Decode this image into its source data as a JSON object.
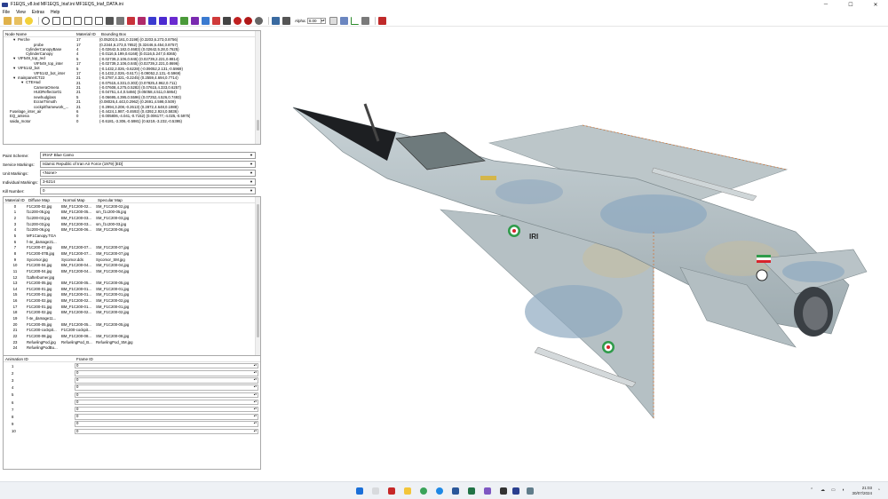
{
  "window": {
    "title": "F1EQS_v8.lod  MF1EQS_Iriaf.ini  MF1EQS_Iriaf_DATA.ini",
    "minimize": "─",
    "maximize": "☐",
    "close": "✕"
  },
  "menu": [
    "File",
    "View",
    "Extras",
    "Help"
  ],
  "toolbar": {
    "alpha_label": "Alpha:",
    "alpha_value": "0.00"
  },
  "tree": {
    "headers": [
      "Node Name",
      "Material ID",
      "Bounding Box"
    ],
    "rows": [
      {
        "name": "Perche",
        "indent": 1,
        "expander": "▾",
        "mat": "17",
        "bbox": "(0.05202,5.161,0.3198) (0.3203,6.273,0.8756)"
      },
      {
        "name": "probe",
        "indent": 3,
        "expander": "",
        "mat": "17",
        "bbox": "(0.2344,6.273,0.7852) (0.32446,6.454,0.8757)"
      },
      {
        "name": "CylinderCanopyBase",
        "indent": 2,
        "expander": "",
        "mat": "4",
        "bbox": "(-0.02642,5.182,0.4683) (0.02642,5.28,0.7625)"
      },
      {
        "name": "CylinderCanopy",
        "indent": 2,
        "expander": "",
        "mat": "4",
        "bbox": "(-0.0116,5.199,0.6168) (0.0116,5.247,0.8365)"
      },
      {
        "name": "VIF549_top_red",
        "indent": 1,
        "expander": "▾",
        "mat": "5",
        "bbox": "(-0.02739,2.106,0.845) (0.02739,2.221,0.8814)"
      },
      {
        "name": "VIF549_top_inter",
        "indent": 3,
        "expander": "",
        "mat": "17",
        "bbox": "(-0.02739,2.106,0.845) (0.02739,2.221,0.8696)"
      },
      {
        "name": "VIF5142_bot",
        "indent": 1,
        "expander": "▾",
        "mat": "5",
        "bbox": "(-0.1432,2.026,-0.6228) (-0.09052,2.131,-0.5969)"
      },
      {
        "name": "VIF5142_bot_inter",
        "indent": 3,
        "expander": "",
        "mat": "17",
        "bbox": "(-0.1432,2.026,-0.617) (-0.09052,2.131,-0.5969)"
      },
      {
        "name": "mainpanelCT22",
        "indent": 1,
        "expander": "▾",
        "mat": "21",
        "bbox": "(-0.2787,4.321,-0.2245) (0.2559,4.694,0.7714)"
      },
      {
        "name": "CTEHud",
        "indent": 2,
        "expander": "▾",
        "mat": "21",
        "bbox": "(-0.07515,4.331,0.303) (0.07825,4.962,0.711)"
      },
      {
        "name": "CameraOmera",
        "indent": 3,
        "expander": "",
        "mat": "21",
        "bbox": "(-0.07608,4.275,0.5282) (0.07615,4.333,0.6257)"
      },
      {
        "name": "HUDReflector01",
        "indent": 3,
        "expander": "",
        "mat": "21",
        "bbox": "(-0.04751,4.4,0.5466) (0.05058,4.511,0.5864)"
      },
      {
        "name": "newhudglass",
        "indent": 3,
        "expander": "",
        "mat": "5",
        "bbox": "(-0.06695,4.395,0.5596) (0.07252,4.526,0.7493)"
      },
      {
        "name": "EcranTrimoth",
        "indent": 3,
        "expander": "",
        "mat": "21",
        "bbox": "(0.08026,4.443,0.2962) (0.2691,4.598,0.509)"
      },
      {
        "name": "cockpitframework_...",
        "indent": 3,
        "expander": "",
        "mat": "21",
        "bbox": "(-0.2994,3.208,-0.2613) (0.2872,4.648,0.1988)"
      },
      {
        "name": "Fuselage_inter_air",
        "indent": 0,
        "expander": "",
        "mat": "6",
        "bbox": "(-0.4424,1.987,-0.4692) (0.4392,2.924,0.5836)"
      },
      {
        "name": "EQ_antena",
        "indent": 0,
        "expander": "",
        "mat": "0",
        "bbox": "(-0.005806,-4.041,-0.7152) (0.006177,-4.025,-0.5975)"
      },
      {
        "name": "saida_motor",
        "indent": 0,
        "expander": "",
        "mat": "0",
        "bbox": "(-0.6181,-3.306,-0.5981) (0.6219,-3.232,-0.5395)"
      }
    ]
  },
  "combos": [
    {
      "label": "Paint Scheme:",
      "value": "IRIAF Blue Camo"
    },
    {
      "label": "Service Markings:",
      "value": "Islamic Republic of Iran Air Force (1979) [ED]"
    },
    {
      "label": "Unit Markings:",
      "value": "<None>"
    },
    {
      "label": "Individual Markings:",
      "value": "3-6214"
    },
    {
      "label": "Kill Number:",
      "value": "0"
    }
  ],
  "materials": {
    "headers": [
      "Material ID",
      "Diffuse Map",
      "Normal Map",
      "Specular Map"
    ],
    "rows": [
      [
        "0",
        "F1C200-02.jpg",
        "BM_F1C200-02...",
        "SM_F1C200-02.jpg"
      ],
      [
        "1",
        "f1c200-05.jpg",
        "BM_F1C200-05...",
        "sm_f1c200-05.jpg"
      ],
      [
        "2",
        "f1c200-03.jpg",
        "BM_F1C200-03...",
        "SM_F1C200-03.jpg"
      ],
      [
        "3",
        "f1c200-03.jpg",
        "BM_F1C200-03...",
        "sm_f1c200-03.jpg"
      ],
      [
        "4",
        "f1c200-06.jpg",
        "BM_F1C200-06...",
        "SM_F1C200-06.jpg"
      ],
      [
        "5",
        "MF1Canopy.TGA",
        "",
        ""
      ],
      [
        "6",
        "f-4e_damage21...",
        "",
        ""
      ],
      [
        "7",
        "F1C200-07.jpg",
        "BM_F1C200-07...",
        "SM_F1C200-07.jpg"
      ],
      [
        "8",
        "F1C200-07B.jpg",
        "BM_F1C200-07...",
        "SM_F1C200-07.jpg"
      ],
      [
        "9",
        "Sycomor.jpg",
        "Sycomor.dds",
        "Sycomor_SM.jpg"
      ],
      [
        "10",
        "F1C200-04.jpg",
        "BM_F1C200-04...",
        "SM_F1C200-04.jpg"
      ],
      [
        "11",
        "F1C200-04.jpg",
        "BM_F1C200-04...",
        "SM_F1C200-04.jpg"
      ],
      [
        "12",
        "f1afterburner.jpg",
        "",
        ""
      ],
      [
        "13",
        "F1C200-05.jpg",
        "BM_F1C200-05...",
        "SM_F1C200-05.jpg"
      ],
      [
        "14",
        "F1C200-01.jpg",
        "BM_F1C200-01...",
        "SM_F1C200-01.jpg"
      ],
      [
        "15",
        "F1C200-01.jpg",
        "BM_F1C200-01...",
        "SM_F1C200-01.jpg"
      ],
      [
        "16",
        "F1C200-02.jpg",
        "BM_F1C200-02...",
        "SM_F1C200-02.jpg"
      ],
      [
        "17",
        "F1C200-01.jpg",
        "BM_F1C200-01...",
        "SM_F1C200-01.jpg"
      ],
      [
        "18",
        "F1C200-02.jpg",
        "BM_F1C200-02...",
        "SM_F1C200-02.jpg"
      ],
      [
        "19",
        "f-4e_damage11...",
        "",
        ""
      ],
      [
        "20",
        "F1C200-05.jpg",
        "BM_F1C200-05...",
        "SM_F1C200-05.jpg"
      ],
      [
        "21",
        "F1C200-cockpit...",
        "F1C200-cockpit...",
        ""
      ],
      [
        "22",
        "F1C200-08.jpg",
        "BM_F1C200-08...",
        "SM_F1C200-08.jpg"
      ],
      [
        "23",
        "RefuelingPod.jpg",
        "RefuelingPod_B...",
        "RefuelingPod_SM.jpg"
      ],
      [
        "24",
        "RefuelingPodBu...",
        "",
        ""
      ]
    ]
  },
  "animations": {
    "headers": [
      "Animation ID",
      "Frame ID"
    ],
    "rows": [
      [
        "1",
        "0"
      ],
      [
        "2",
        "0"
      ],
      [
        "3",
        "0"
      ],
      [
        "4",
        "0"
      ],
      [
        "5",
        "0"
      ],
      [
        "6",
        "0"
      ],
      [
        "7",
        "0"
      ],
      [
        "8",
        "0"
      ],
      [
        "9",
        "0"
      ],
      [
        "10",
        "0"
      ]
    ]
  },
  "aircraft": {
    "tail_serial": "IRI",
    "fuselage_code": "3-6214",
    "roundel_colors": [
      "#2f9b4a",
      "#ffffff",
      "#d8232a"
    ],
    "camo_light": "#b7c4c9",
    "camo_blue": "#8fa9c0",
    "camo_tan": "#c7bd9e"
  },
  "taskbar": {
    "time": "21:03",
    "date": "30/07/2024"
  }
}
